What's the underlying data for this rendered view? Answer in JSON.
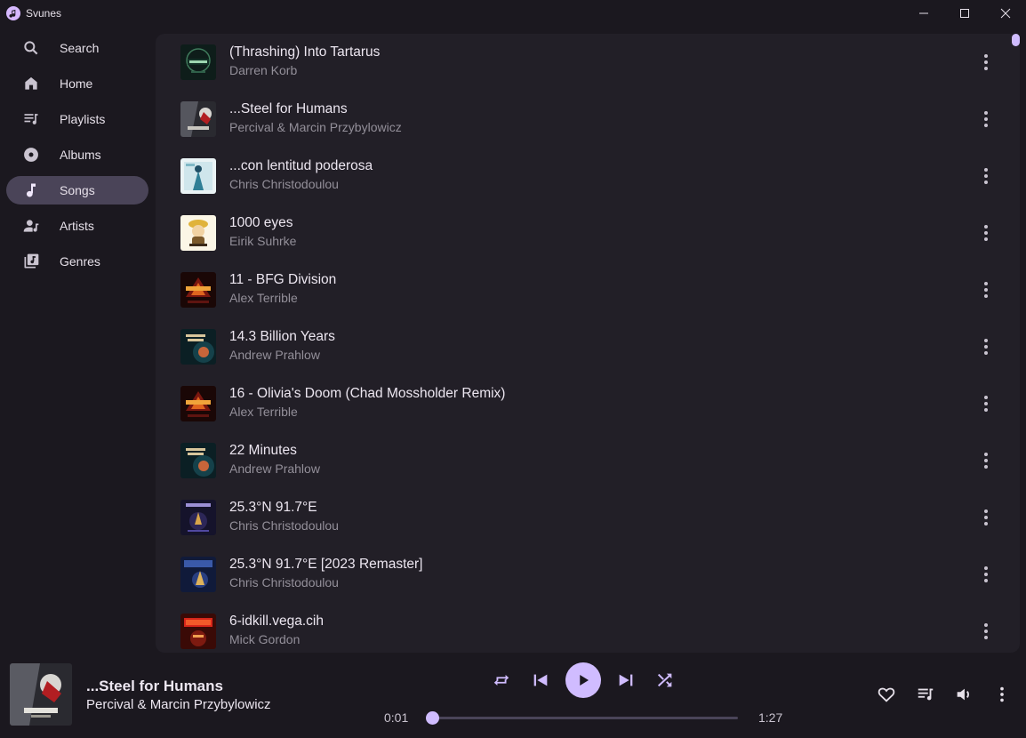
{
  "window": {
    "title": "Svunes"
  },
  "sidebar": {
    "items": [
      {
        "label": "Search",
        "icon": "search-icon"
      },
      {
        "label": "Home",
        "icon": "home-icon"
      },
      {
        "label": "Playlists",
        "icon": "playlist-icon"
      },
      {
        "label": "Albums",
        "icon": "album-icon"
      },
      {
        "label": "Songs",
        "icon": "music-note-icon",
        "active": true
      },
      {
        "label": "Artists",
        "icon": "artist-icon"
      },
      {
        "label": "Genres",
        "icon": "genre-icon"
      }
    ],
    "bottom_icons": [
      "settings-icon",
      "grid-icon"
    ]
  },
  "songs": [
    {
      "title": "(Thrashing) Into Tartarus",
      "artist": "Darren Korb"
    },
    {
      "title": "...Steel for Humans",
      "artist": "Percival & Marcin Przybylowicz"
    },
    {
      "title": "...con lentitud poderosa",
      "artist": "Chris Christodoulou"
    },
    {
      "title": "1000 eyes",
      "artist": "Eirik Suhrke"
    },
    {
      "title": "11 - BFG Division",
      "artist": "Alex Terrible"
    },
    {
      "title": "14.3 Billion Years",
      "artist": "Andrew Prahlow"
    },
    {
      "title": "16 - Olivia's Doom (Chad Mossholder Remix)",
      "artist": "Alex Terrible"
    },
    {
      "title": "22 Minutes",
      "artist": "Andrew Prahlow"
    },
    {
      "title": "25.3°N 91.7°E",
      "artist": "Chris Christodoulou"
    },
    {
      "title": "25.3°N 91.7°E [2023 Remaster]",
      "artist": "Chris Christodoulou"
    },
    {
      "title": "6-idkill.vega.cih",
      "artist": "Mick Gordon"
    }
  ],
  "player": {
    "title": "...Steel for Humans",
    "artist": "Percival & Marcin Przybylowicz",
    "elapsed": "0:01",
    "duration": "1:27",
    "progress": 0.0
  },
  "colors": {
    "background": "#1b181f",
    "panel": "#221f27",
    "accent": "#d0bcff",
    "active_nav": "#4a4458",
    "muted_text": "#938f99"
  }
}
